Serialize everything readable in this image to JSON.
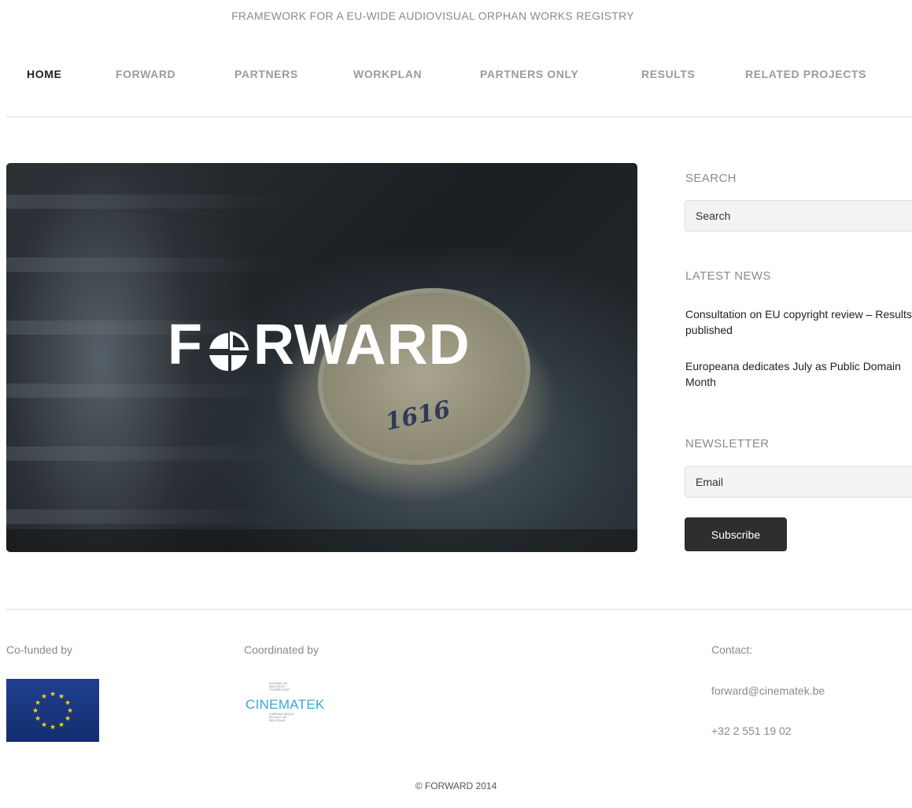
{
  "site": {
    "tagline": "FRAMEWORK FOR A EU-WIDE AUDIOVISUAL ORPHAN WORKS REGISTRY"
  },
  "nav": {
    "items": [
      {
        "label": "HOME",
        "active": true
      },
      {
        "label": "FORWARD",
        "active": false
      },
      {
        "label": "PARTNERS",
        "active": false
      },
      {
        "label": "WORKPLAN",
        "active": false
      },
      {
        "label": "PARTNERS ONLY",
        "active": false
      },
      {
        "label": "RESULTS",
        "active": false
      },
      {
        "label": "RELATED PROJECTS",
        "active": false
      }
    ]
  },
  "hero": {
    "logo_left": "F",
    "logo_right": "RWARD",
    "reel_number": "1616"
  },
  "sidebar": {
    "search": {
      "heading": "SEARCH",
      "placeholder": "Search"
    },
    "news": {
      "heading": "LATEST NEWS",
      "items": [
        {
          "title": "Consultation on EU copyright review – Results published"
        },
        {
          "title": "Europeana dedicates July as Public Domain Month"
        }
      ]
    },
    "newsletter": {
      "heading": "NEWSLETTER",
      "placeholder": "Email",
      "button_label": "Subscribe"
    }
  },
  "footer": {
    "cofunded_label": "Co-funded by",
    "coordinated_label": "Coordinated by",
    "cinematek": {
      "top_text": "KONINKLIJK BELGISCH FILMARCHIEF",
      "name": "CINEMATEK",
      "bottom_text": "CINÉMATHÈQUE ROYALE DE BELGIQUE"
    },
    "contact_label": "Contact:",
    "email": "forward@cinematek.be",
    "phone": "+32 2 551 19 02",
    "copyright": "© FORWARD 2014"
  },
  "colors": {
    "nav_active": "#222222",
    "nav_inactive": "#9b9b9b",
    "button_bg": "#2e2e2e",
    "cinematek_blue": "#3aa8d8",
    "eu_blue": "#1f3f8f",
    "eu_star": "#f7d117"
  }
}
